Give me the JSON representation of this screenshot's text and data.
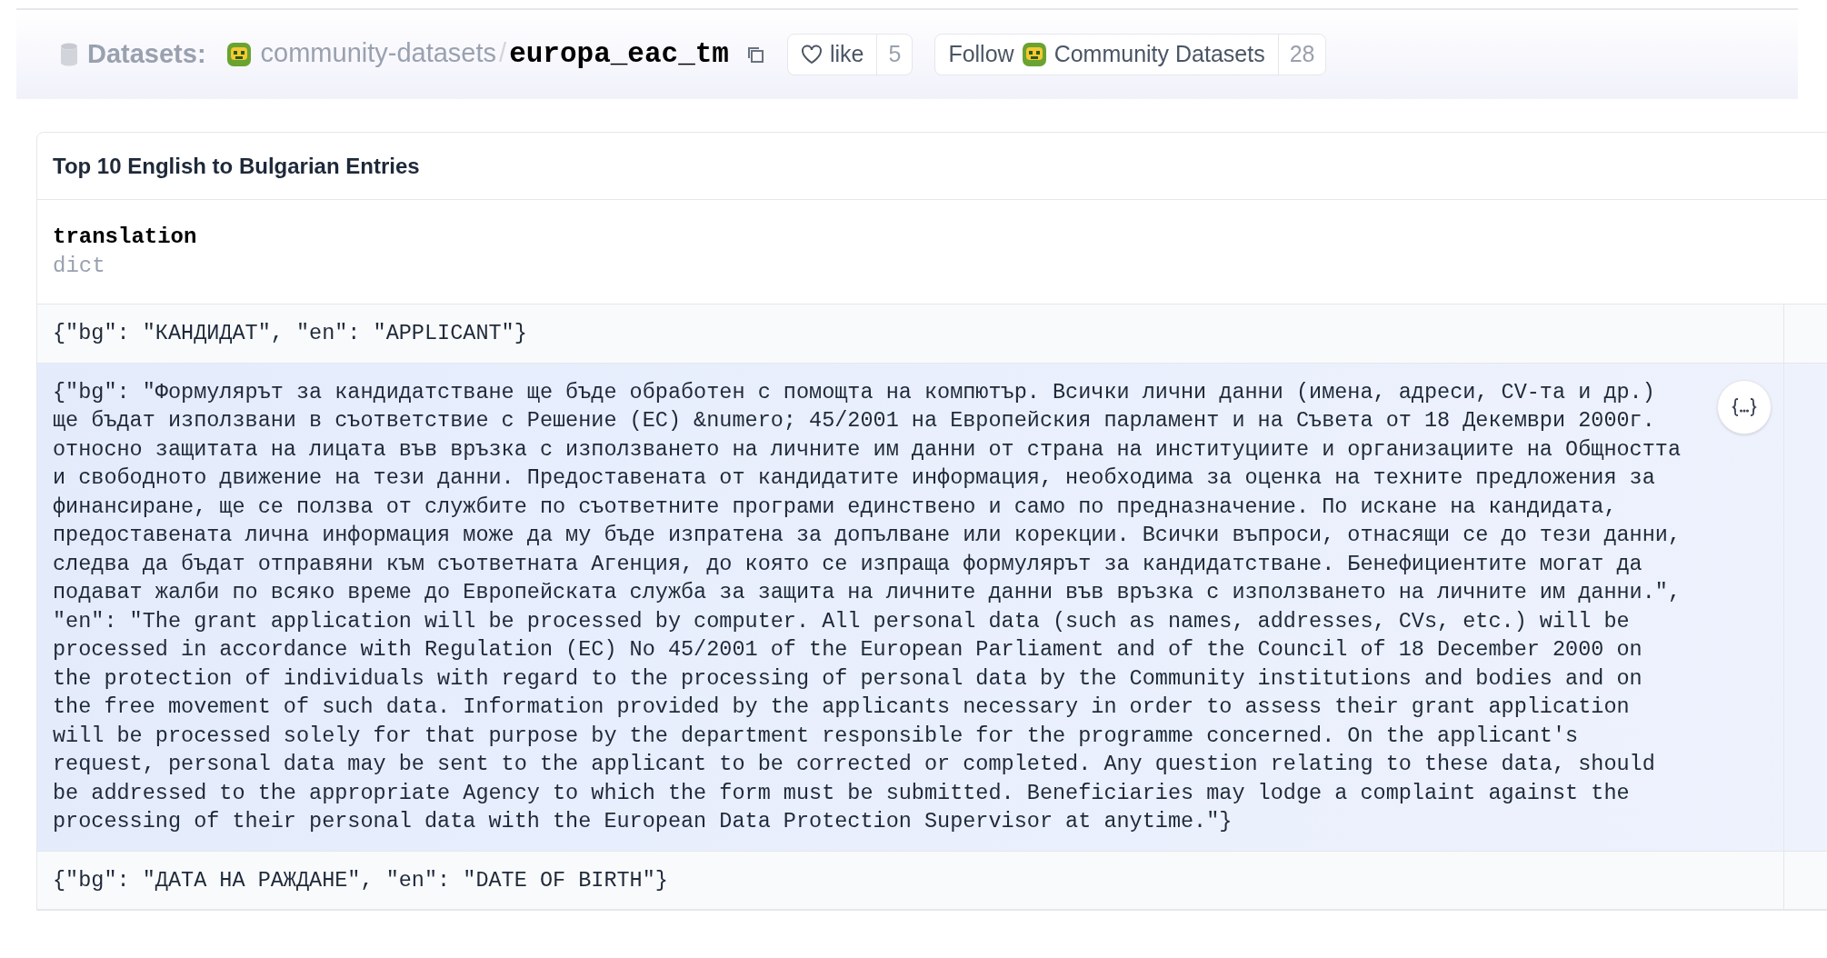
{
  "header": {
    "section": "Datasets:",
    "owner": "community-datasets",
    "separator": "/",
    "name": "europa_eac_tm",
    "like": {
      "label": "like",
      "count": "5"
    },
    "follow": {
      "label": "Follow",
      "org": "Community Datasets",
      "count": "28"
    }
  },
  "card": {
    "title": "Top 10 English to Bulgarian Entries",
    "column": {
      "name": "translation",
      "type": "dict"
    },
    "rows": [
      {
        "text": "{\"bg\": \"КАНДИДАТ\", \"en\": \"APPLICANT\"}",
        "selected": false
      },
      {
        "text": "{\"bg\": \"Формулярът за кандидатстване ще бъде обработен с помощта на компютър. Всички лични данни (имена, адреси, CV-та и др.) ще бъдат използвани в съответствие с Решение (ЕС) &numero; 45/2001 на Европейския парламент и на Съвета от 18 Декември 2000г. относно защитата на лицата във връзка с използването на личните им данни от страна на институциите и организациите на Общността и свободното движение на тези данни. Предоставената от кандидатите информация, необходима за оценка на техните предложения за финансиране, ще се ползва от службите по съответните програми единствено и само по предназначение. По искане на кандидата, предоставената лична информация може да му бъде изпратена за допълване или корекции. Всички въпроси, отнасящи се до тези данни, следва да бъдат отправяни към съответната Агенция, до която се изпраща формулярът за кандидатстване. Бенефициентите могат да подават жалби по всяко време до Европейската служба за защита на личните данни във връзка с използването на личните им данни.\", \"en\": \"The grant application will be processed by computer. All personal data (such as names, addresses, CVs, etc.) will be processed in accordance with Regulation (EC) No 45/2001 of the European Parliament and of the Council of 18 December 2000 on the protection of individuals with regard to the processing of personal data by the Community institutions and bodies and on the free movement of such data. Information provided by the applicants necessary in order to assess their grant application will be processed solely for that purpose by the department responsible for the programme concerned. On the applicant's request, personal data may be sent to the applicant to be corrected or completed. Any question relating to these data, should be addressed to the appropriate Agency to which the form must be submitted. Beneficiaries may lodge a complaint against the processing of their personal data with the European Data Protection Supervisor at anytime.\"}",
        "selected": true
      },
      {
        "text": "{\"bg\": \"ДАТА НА РАЖДАНЕ\", \"en\": \"DATE OF BIRTH\"}",
        "selected": false
      }
    ]
  }
}
